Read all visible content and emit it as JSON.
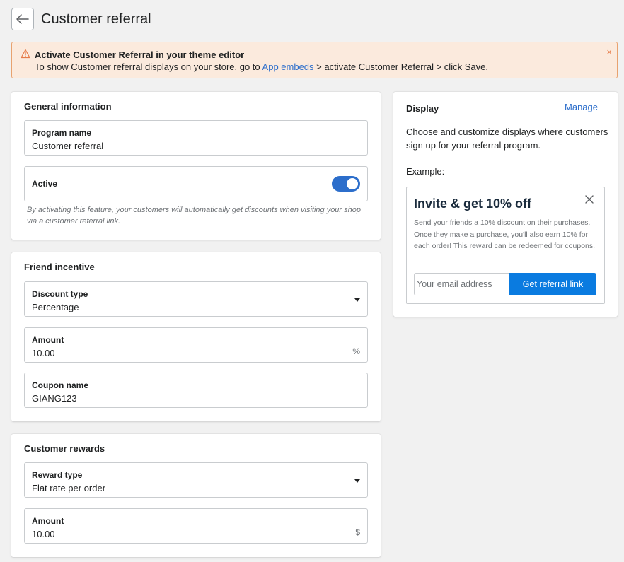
{
  "header": {
    "title": "Customer referral",
    "back_icon": "arrow-left-icon"
  },
  "banner": {
    "title": "Activate Customer Referral in your theme editor",
    "text_before": "To show Customer referral displays on your store, go to ",
    "link": "App embeds",
    "text_mid": " > activate ",
    "bold1": "Customer Referral",
    "text_mid2": " > click ",
    "bold2": "Save",
    "text_end": ".",
    "icon": "warning-icon",
    "close": "×",
    "accent": "#e8a26f",
    "background": "#fbeadd"
  },
  "general": {
    "title": "General information",
    "program_name": {
      "label": "Program name",
      "value": "Customer referral"
    },
    "active": {
      "label": "Active",
      "checked": true
    },
    "hint": "By activating this feature, your customers will automatically get discounts when visiting your shop via a customer referral link."
  },
  "friend": {
    "title": "Friend incentive",
    "discount_type": {
      "label": "Discount type",
      "value": "Percentage"
    },
    "amount": {
      "label": "Amount",
      "value": "10.00",
      "suffix": "%"
    },
    "coupon": {
      "label": "Coupon name",
      "value": "GIANG123"
    }
  },
  "rewards": {
    "title": "Customer rewards",
    "reward_type": {
      "label": "Reward type",
      "value": "Flat rate per order"
    },
    "amount": {
      "label": "Amount",
      "value": "10.00",
      "suffix": "$"
    }
  },
  "display": {
    "title": "Display",
    "manage": "Manage",
    "description": "Choose and customize displays where customers sign up for your referral program.",
    "example_label": "Example:",
    "example": {
      "title": "Invite & get 10% off",
      "text": "Send your friends a 10% discount on their purchases. Once they make a purchase, you'll also earn 10% for each order! This reward can be redeemed for coupons.",
      "email_placeholder": "Your email address",
      "button": "Get referral link",
      "button_color": "#0a7be0"
    }
  },
  "colors": {
    "accent": "#2c6ecb",
    "background": "#f1f1f1"
  }
}
